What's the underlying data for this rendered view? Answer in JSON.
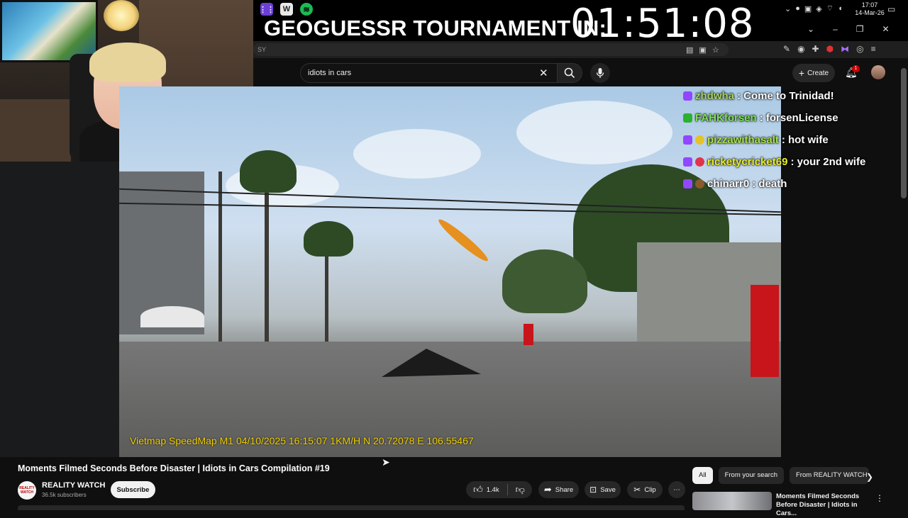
{
  "overlay": {
    "tournament_text": "GEOGUESSR TOURNAMENT IN:",
    "countdown": "01:51:08"
  },
  "system": {
    "time": "17:07",
    "date": "14-Mar-26",
    "taskbar_apps": [
      "grid-app-icon",
      "word-app-icon",
      "spotify-icon"
    ]
  },
  "browser": {
    "url_fragment": "SY"
  },
  "youtube": {
    "search_query": "idiots in cars",
    "create_label": "Create",
    "notification_count": "1",
    "video": {
      "dashcam_overlay": "Vietmap SpeedMap M1 04/10/2025 16:15:07   1KM/H  N 20.72078  E 106.55467",
      "title": "Moments Filmed Seconds Before Disaster | Idiots in Cars Compilation #19",
      "channel_name": "REALITY WATCH",
      "channel_logo_text": "REALITY WATCH",
      "subscribers": "36.5k subscribers",
      "subscribe_label": "Subscribe",
      "likes": "1.4k",
      "share_label": "Share",
      "save_label": "Save",
      "clip_label": "Clip"
    },
    "chips": [
      "All",
      "From your search",
      "From REALITY WATCH"
    ],
    "recommendation": {
      "title": "Moments Filmed Seconds Before Disaster | Idiots in Cars..."
    }
  },
  "chat": [
    {
      "user": "zhdwha",
      "message": ": Come to Trinidad!",
      "color": "#a5d36b",
      "badges": [
        "purple"
      ]
    },
    {
      "user": "FAHKforsen",
      "message": ": forsenLicense",
      "color": "#7ee05a",
      "badges": [
        "green-k"
      ]
    },
    {
      "user": "pizzawithasalt",
      "message": ": hot wife",
      "color": "#a8e04f",
      "badges": [
        "purple",
        "yellow"
      ]
    },
    {
      "user": "ricketycricket69",
      "message": ": your 2nd wife",
      "color": "#e8ef2a",
      "badges": [
        "purple",
        "heart"
      ]
    },
    {
      "user": "chinarr0",
      "message": ": death",
      "color": "#ffffff",
      "badges": [
        "purple",
        "brown"
      ]
    }
  ],
  "colors": {
    "background": "#0f0f0f",
    "accent_red": "#cc0000",
    "dashcam_text": "#f3d000"
  }
}
